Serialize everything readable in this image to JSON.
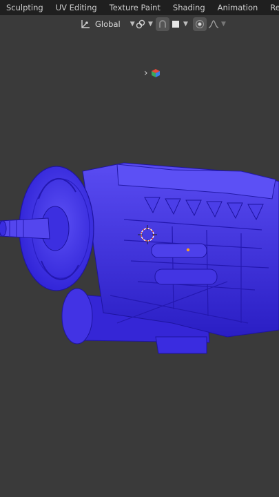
{
  "workspace_tabs": [
    {
      "label": "Sculpting"
    },
    {
      "label": "UV Editing"
    },
    {
      "label": "Texture Paint"
    },
    {
      "label": "Shading"
    },
    {
      "label": "Animation"
    },
    {
      "label": "Rendering"
    }
  ],
  "header": {
    "orientation_label": "Global",
    "orientation_icon": "transform-orientation-icon",
    "pivot_icon": "pivot-link-icon",
    "snap_icon": "snap-icon",
    "snap_target_icon": "snap-square-icon",
    "proportional_icon": "proportional-editing-icon",
    "falloff_icon": "falloff-curve-icon"
  },
  "viewport": {
    "expand_icon": "expand-chevron-icon",
    "gizmo_icon": "color-cube-icon",
    "object_color": "#3f2fe8",
    "background_color": "#3a3a3a"
  }
}
